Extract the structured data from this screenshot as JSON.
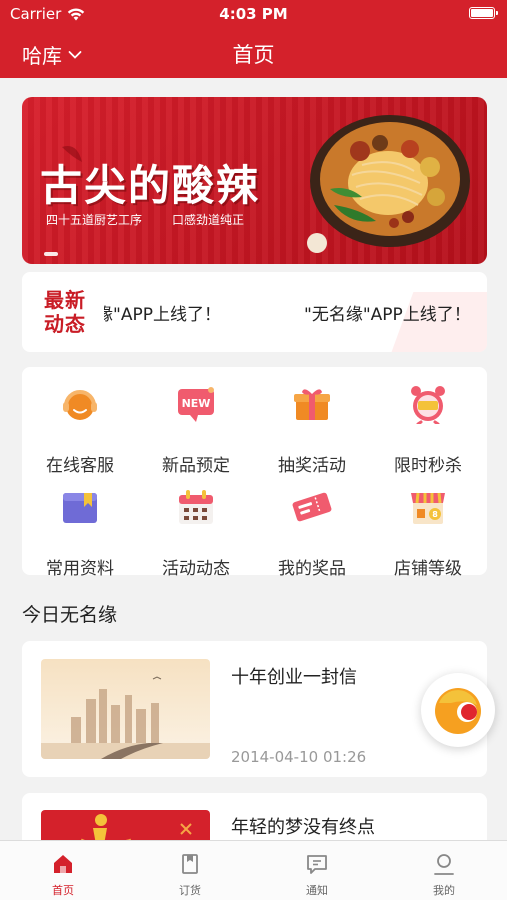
{
  "status_bar": {
    "carrier": "Carrier",
    "time": "4:03 PM"
  },
  "nav": {
    "city": "哈库",
    "title": "首页"
  },
  "banner": {
    "headline": "古尖的酸辣",
    "sub1": "四十五道厨艺工序",
    "sub2": "口感劲道纯正"
  },
  "news": {
    "tag_line1": "最新",
    "tag_line2": "动态",
    "ticker_prev": "缘\"APP上线了！",
    "ticker_next": "\"无名缘\"APP上线了！"
  },
  "menu": [
    {
      "label": "在线客服",
      "icon": "headset-icon"
    },
    {
      "label": "新品预定",
      "icon": "new-badge-icon"
    },
    {
      "label": "抽奖活动",
      "icon": "gift-box-icon"
    },
    {
      "label": "限时秒杀",
      "icon": "alarm-clock-icon"
    },
    {
      "label": "常用资料",
      "icon": "folder-icon"
    },
    {
      "label": "活动动态",
      "icon": "calendar-icon"
    },
    {
      "label": "我的奖品",
      "icon": "ticket-icon"
    },
    {
      "label": "店铺等级",
      "icon": "shop-icon"
    }
  ],
  "section": {
    "title": "今日无名缘"
  },
  "articles": [
    {
      "title": "十年创业一封信",
      "date": "2014-04-10 01:26"
    },
    {
      "title": "年轻的梦没有终点",
      "date": ""
    }
  ],
  "tabs": [
    {
      "label": "首页",
      "icon": "home-icon",
      "active": true
    },
    {
      "label": "订货",
      "icon": "order-icon",
      "active": false
    },
    {
      "label": "通知",
      "icon": "message-icon",
      "active": false
    },
    {
      "label": "我的",
      "icon": "profile-icon",
      "active": false
    }
  ],
  "colors": {
    "brand_red": "#d4212b",
    "icon_orange": "#f08a24",
    "icon_pink": "#f05b6e",
    "icon_purple": "#6f6bd6"
  }
}
